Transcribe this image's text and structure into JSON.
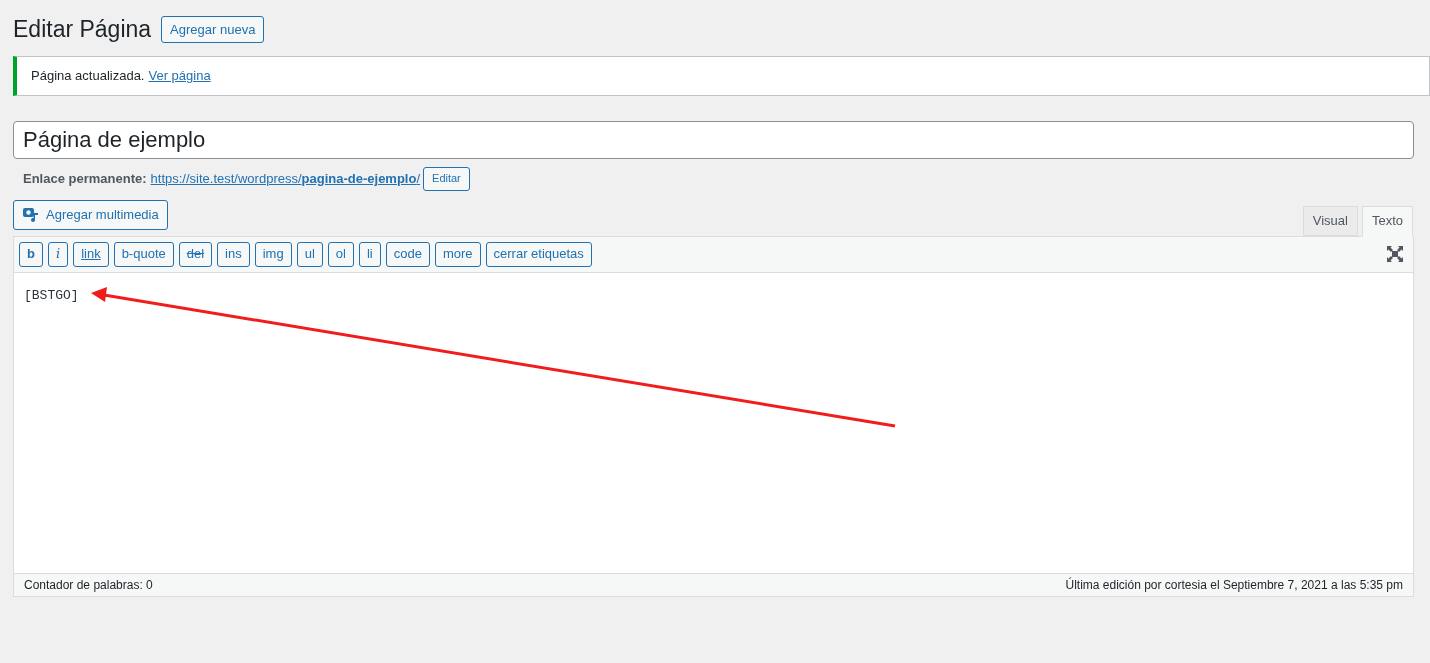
{
  "header": {
    "title": "Editar Página",
    "add_new": "Agregar nueva"
  },
  "notice": {
    "text": "Página actualizada.",
    "link": "Ver página"
  },
  "title_field": {
    "value": "Página de ejemplo"
  },
  "permalink": {
    "label": "Enlace permanente:",
    "url": "https://site.test/wordpress/**pagina-de-ejemplo**/",
    "edit": "Editar"
  },
  "media_button": "Agregar multimedia",
  "tabs": [
    {
      "label": "Visual",
      "selected": false
    },
    {
      "label": "Texto",
      "selected": true
    }
  ],
  "toolbar": [
    {
      "label": "b",
      "kind": "bold"
    },
    {
      "label": "i",
      "kind": "italic"
    },
    {
      "label": "link",
      "kind": "link"
    },
    {
      "label": "b-quote",
      "kind": "plain"
    },
    {
      "label": "del",
      "kind": "strike"
    },
    {
      "label": "ins",
      "kind": "plain"
    },
    {
      "label": "img",
      "kind": "plain"
    },
    {
      "label": "ul",
      "kind": "plain"
    },
    {
      "label": "ol",
      "kind": "plain"
    },
    {
      "label": "li",
      "kind": "plain"
    },
    {
      "label": "code",
      "kind": "plain"
    },
    {
      "label": "more",
      "kind": "plain"
    },
    {
      "label": "cerrar etiquetas",
      "kind": "plain"
    }
  ],
  "editor": {
    "content": "[BSTGO]"
  },
  "status_bar": {
    "word_count": "Contador de palabras: 0",
    "last_edit": "Última edición por cortesia el Septiembre 7, 2021 a las 5:35 pm"
  }
}
